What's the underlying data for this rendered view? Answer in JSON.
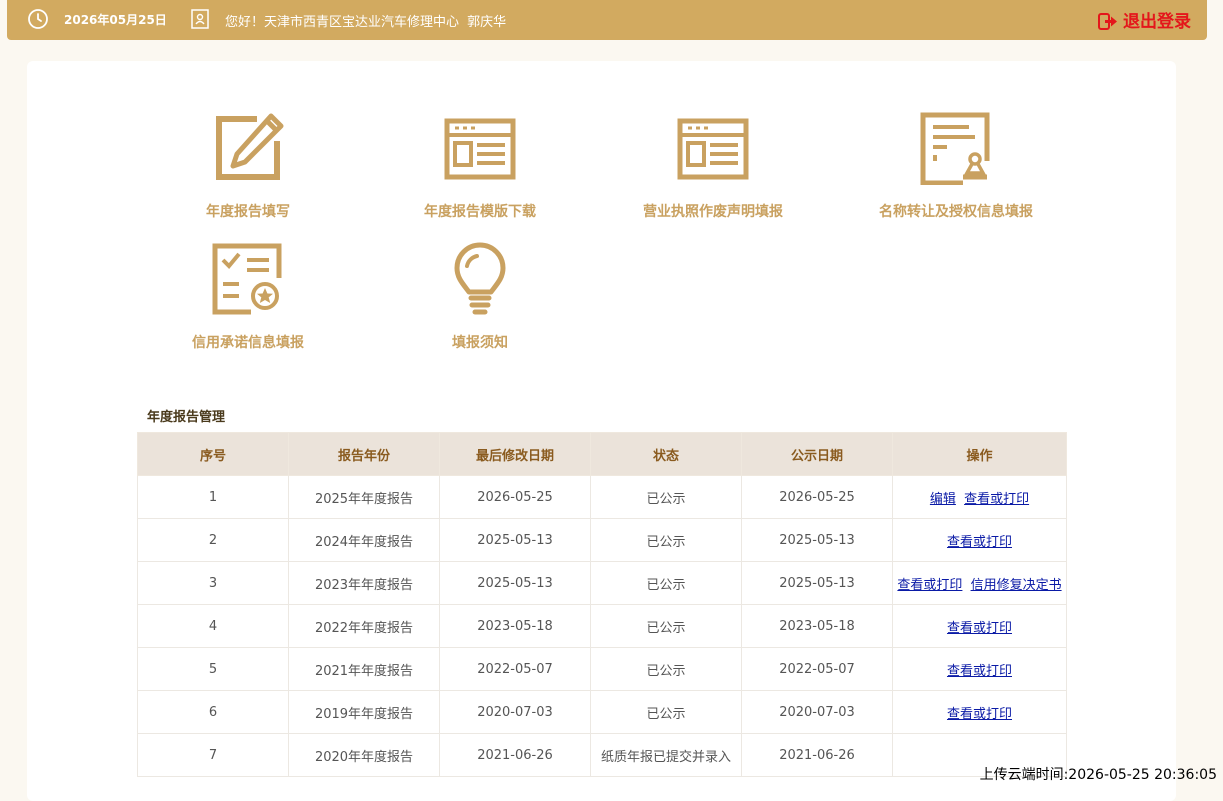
{
  "header": {
    "date": "2026年05月25日",
    "greeting": "您好！天津市西青区宝达业汽车修理中心",
    "user_name": "郭庆华",
    "logout_label": "退出登录",
    "bg_color": "#d2aa60",
    "logout_color": "#e4161b"
  },
  "tiles": [
    {
      "label": "年度报告填写",
      "icon": "edit-icon"
    },
    {
      "label": "年度报告模版下载",
      "icon": "template-icon"
    },
    {
      "label": "营业执照作废声明填报",
      "icon": "license-icon"
    },
    {
      "label": "名称转让及授权信息填报",
      "icon": "stamp-doc-icon"
    },
    {
      "label": "信用承诺信息填报",
      "icon": "checklist-icon"
    },
    {
      "label": "填报须知",
      "icon": "lightbulb-icon"
    }
  ],
  "section_title": "年度报告管理",
  "table": {
    "columns": [
      "序号",
      "报告年份",
      "最后修改日期",
      "状态",
      "公示日期",
      "操作"
    ],
    "rows": [
      {
        "no": "1",
        "year": "2025年年度报告",
        "modified": "2026-05-25",
        "status": "已公示",
        "published": "2026-05-25",
        "actions": [
          "编辑",
          "查看或打印"
        ]
      },
      {
        "no": "2",
        "year": "2024年年度报告",
        "modified": "2025-05-13",
        "status": "已公示",
        "published": "2025-05-13",
        "actions": [
          "查看或打印"
        ]
      },
      {
        "no": "3",
        "year": "2023年年度报告",
        "modified": "2025-05-13",
        "status": "已公示",
        "published": "2025-05-13",
        "actions": [
          "查看或打印",
          "信用修复决定书"
        ]
      },
      {
        "no": "4",
        "year": "2022年年度报告",
        "modified": "2023-05-18",
        "status": "已公示",
        "published": "2023-05-18",
        "actions": [
          "查看或打印"
        ]
      },
      {
        "no": "5",
        "year": "2021年年度报告",
        "modified": "2022-05-07",
        "status": "已公示",
        "published": "2022-05-07",
        "actions": [
          "查看或打印"
        ]
      },
      {
        "no": "6",
        "year": "2019年年度报告",
        "modified": "2020-07-03",
        "status": "已公示",
        "published": "2020-07-03",
        "actions": [
          "查看或打印"
        ]
      },
      {
        "no": "7",
        "year": "2020年年度报告",
        "modified": "2021-06-26",
        "status": "纸质年报已提交并录入",
        "published": "2021-06-26",
        "actions": []
      }
    ]
  },
  "upload_time": "上传云端时间:2026-05-25 20:36:05",
  "accent_color": "#c9a160"
}
